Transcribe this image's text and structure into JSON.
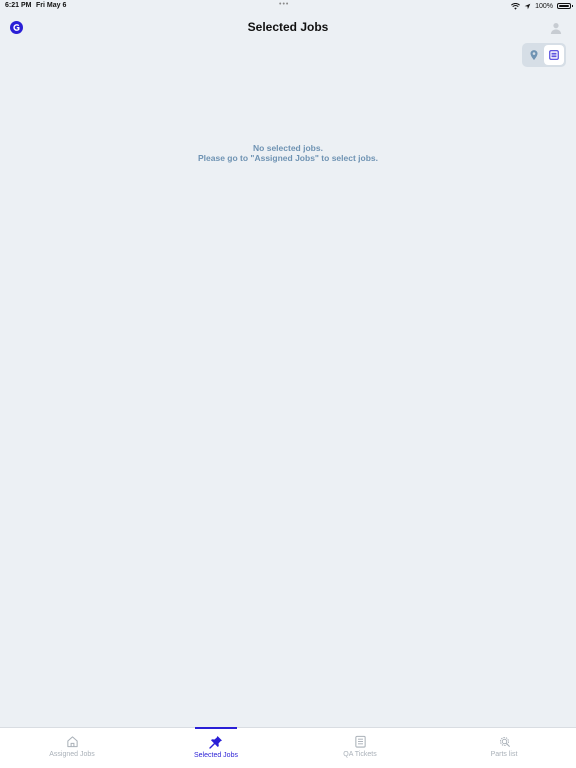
{
  "status_bar": {
    "time": "6:21 PM",
    "date": "Fri May 6",
    "battery": "100%"
  },
  "header": {
    "title": "Selected Jobs"
  },
  "view_toggle": {
    "options": [
      "map-pin-icon",
      "list-icon"
    ],
    "active": "list-icon"
  },
  "empty_state": {
    "line1": "No selected jobs.",
    "line2": "Please go to \"Assigned Jobs\" to select jobs."
  },
  "tabs": [
    {
      "label": "Assigned Jobs",
      "icon": "home-icon",
      "active": false
    },
    {
      "label": "Selected Jobs",
      "icon": "pin-icon",
      "active": true
    },
    {
      "label": "QA Tickets",
      "icon": "clipboard-icon",
      "active": false
    },
    {
      "label": "Parts list",
      "icon": "gear-icon",
      "active": false
    }
  ],
  "colors": {
    "accent": "#2a1fd6",
    "background": "#ecf0f4",
    "empty_text": "#6f93b3",
    "inactive_tab": "#a9b0b8"
  }
}
